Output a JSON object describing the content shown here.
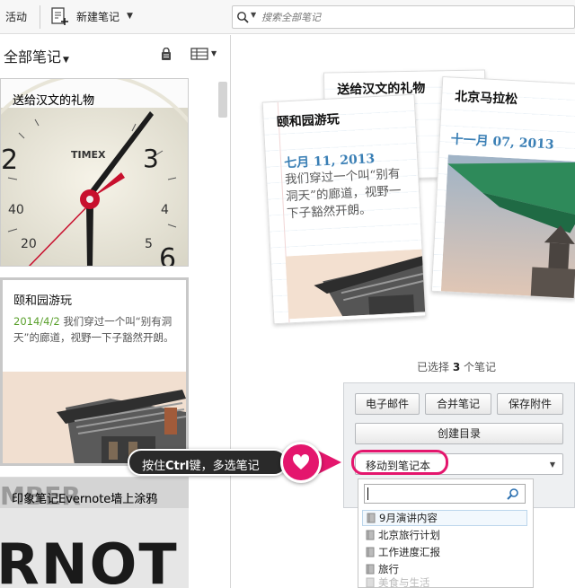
{
  "toolbar": {
    "activity_label": "活动",
    "new_note_label": "新建笔记",
    "search_placeholder": "搜索全部笔记"
  },
  "left_panel": {
    "title": "全部笔记",
    "notes": [
      {
        "title": "送给汉文的礼物",
        "image": "clock-photo"
      },
      {
        "title": "颐和园游玩",
        "date": "2014/4/2",
        "snippet": "我们穿过一个叫“别有洞天”的廊道，视野一下子豁然开朗。",
        "image": "pagoda-photo"
      },
      {
        "title": "印象笔记Evernote墙上涂鸦",
        "image": "evernote-wall-photo"
      }
    ],
    "clock_brand": "TIMEX",
    "clock_numbers": [
      "2",
      "3",
      "4",
      "5",
      "6",
      "20",
      "40"
    ]
  },
  "right_panel": {
    "stack": [
      {
        "title": "送给汉文的礼物"
      },
      {
        "title": "北京马拉松",
        "date": "十一月 07, 2013"
      },
      {
        "title": "颐和园游玩",
        "date": "七月 11, 2013",
        "text": "我们穿过一个叫“别有洞天”的廊道，视野一下子豁然开朗。"
      }
    ],
    "selected_prefix": "已选择",
    "selected_count": "3",
    "selected_suffix": "个笔记",
    "buttons": {
      "email": "电子邮件",
      "merge": "合并笔记",
      "attachment": "保存附件",
      "toc": "创建目录"
    },
    "move_select": "移动到笔记本",
    "notebooks": [
      "9月演讲内容",
      "北京旅行计划",
      "工作进度汇报",
      "旅行",
      "美食与生活"
    ]
  },
  "tooltip": {
    "prefix": "按住",
    "key": "Ctrl",
    "suffix": "键，多选笔记"
  },
  "colors": {
    "accent": "#e4166d",
    "date_green": "#5aa02c",
    "date_blue": "#3a7fb5"
  }
}
